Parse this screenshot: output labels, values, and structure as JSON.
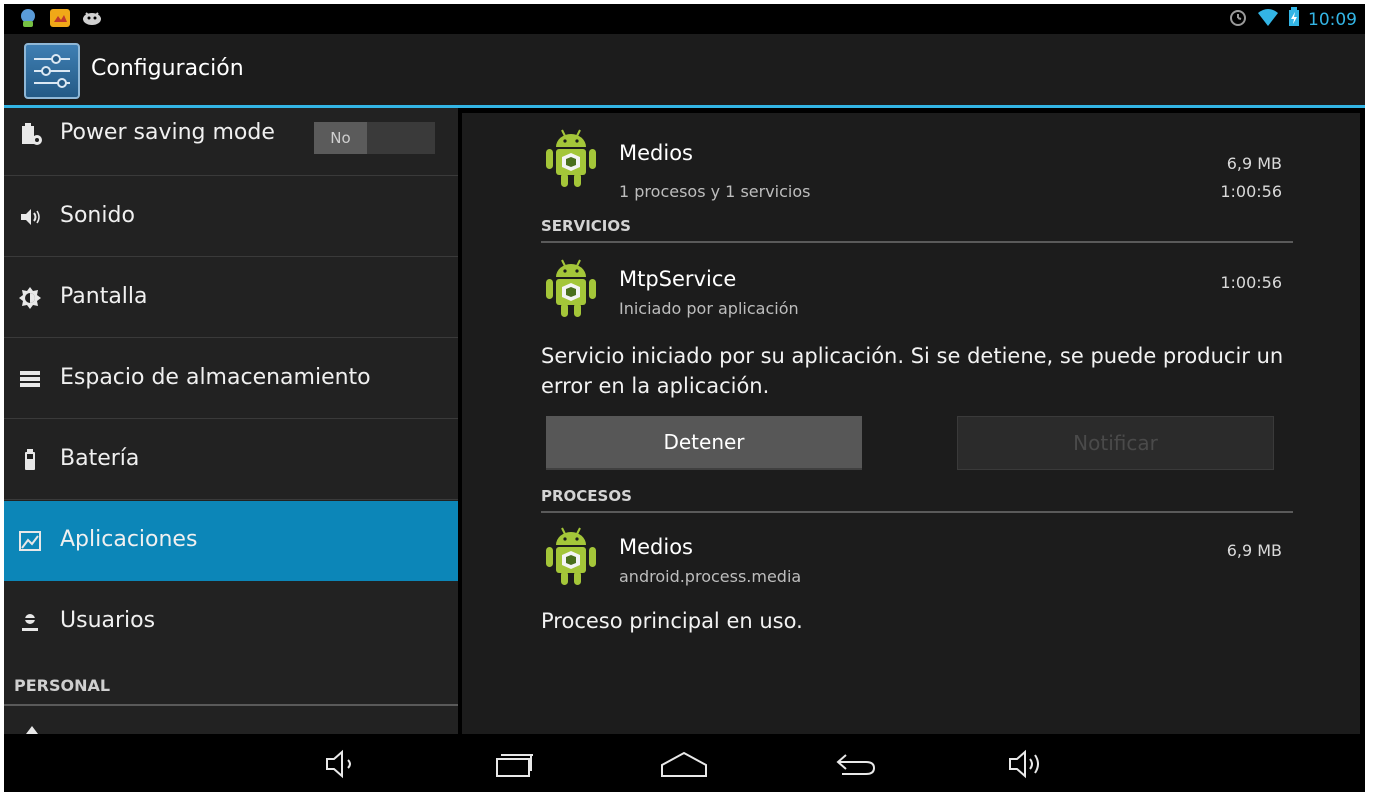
{
  "status_bar": {
    "time": "10:09",
    "left_icons": [
      "notification-app-icon",
      "photo-app-icon",
      "android-debug-icon"
    ],
    "right_icons": [
      "alarm-icon",
      "wifi-icon",
      "battery-charging-icon"
    ]
  },
  "action_bar": {
    "title": "Configuración",
    "icon": "settings-sliders-icon"
  },
  "sidebar": {
    "items": [
      {
        "label": "Power saving mode",
        "icon": "power-saving-icon",
        "toggle": "No"
      },
      {
        "label": "Sonido",
        "icon": "speaker-icon"
      },
      {
        "label": "Pantalla",
        "icon": "brightness-icon"
      },
      {
        "label": "Espacio de almacenamiento",
        "icon": "storage-icon"
      },
      {
        "label": "Batería",
        "icon": "battery-icon"
      },
      {
        "label": "Aplicaciones",
        "icon": "apps-icon",
        "selected": true
      },
      {
        "label": "Usuarios",
        "icon": "user-icon"
      }
    ],
    "section_header": "PERSONAL"
  },
  "detail": {
    "app": {
      "name": "Medios",
      "sub": "1 procesos y 1 servicios",
      "size": "6,9 MB",
      "time": "1:00:56"
    },
    "services_header": "SERVICIOS",
    "service": {
      "name": "MtpService",
      "sub": "Iniciado por aplicación",
      "time": "1:00:56"
    },
    "service_desc": "Servicio iniciado por su aplicación. Si se detiene, se puede producir un error en la aplicación.",
    "stop_label": "Detener",
    "notify_label": "Notificar",
    "processes_header": "PROCESOS",
    "process": {
      "name": "Medios",
      "sub": "android.process.media",
      "size": "6,9 MB"
    },
    "process_desc": "Proceso principal en uso."
  },
  "nav_bar": {
    "buttons": [
      "volume-down-icon",
      "recents-icon",
      "home-icon",
      "back-icon",
      "volume-up-icon"
    ]
  },
  "colors": {
    "accent": "#33b5e5",
    "selected": "#0c86b8"
  }
}
